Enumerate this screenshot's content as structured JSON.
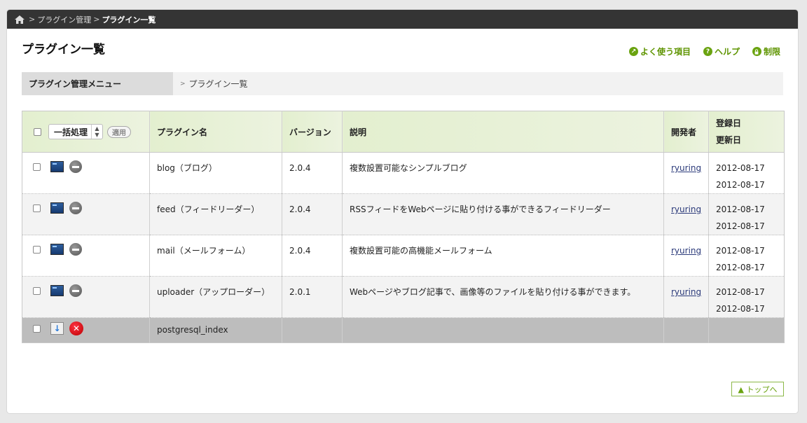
{
  "breadcrumb": {
    "items": [
      "プラグイン管理"
    ],
    "current": "プラグイン一覧",
    "sep": ">"
  },
  "page": {
    "title": "プラグイン一覧"
  },
  "top_links": {
    "favorites": "よく使う項目",
    "help": "ヘルプ",
    "restrict": "制限"
  },
  "menu": {
    "label": "プラグイン管理メニュー",
    "items": [
      "プラグイン一覧"
    ]
  },
  "table": {
    "bulk_label": "一括処理",
    "apply_label": "適用",
    "headers": {
      "name": "プラグイン名",
      "version": "バージョン",
      "desc": "説明",
      "dev": "開発者",
      "created": "登録日",
      "updated": "更新日"
    },
    "rows": [
      {
        "name": "blog（ブログ）",
        "version": "2.0.4",
        "desc": "複数設置可能なシンプルブログ",
        "dev": "ryuring",
        "created": "2012-08-17",
        "updated": "2012-08-17"
      },
      {
        "name": "feed（フィードリーダー）",
        "version": "2.0.4",
        "desc": "RSSフィードをWebページに貼り付ける事ができるフィードリーダー",
        "dev": "ryuring",
        "created": "2012-08-17",
        "updated": "2012-08-17"
      },
      {
        "name": "mail（メールフォーム）",
        "version": "2.0.4",
        "desc": "複数設置可能の高機能メールフォーム",
        "dev": "ryuring",
        "created": "2012-08-17",
        "updated": "2012-08-17"
      },
      {
        "name": "uploader（アップローダー）",
        "version": "2.0.1",
        "desc": "Webページやブログ記事で、画像等のファイルを貼り付ける事ができます。",
        "dev": "ryuring",
        "created": "2012-08-17",
        "updated": "2012-08-17"
      },
      {
        "name": "postgresql_index",
        "version": "",
        "desc": "",
        "dev": "",
        "created": "",
        "updated": ""
      }
    ]
  },
  "to_top": "▲ トップへ",
  "colors": {
    "accent": "#6aa310",
    "header_bar": "#343434"
  }
}
